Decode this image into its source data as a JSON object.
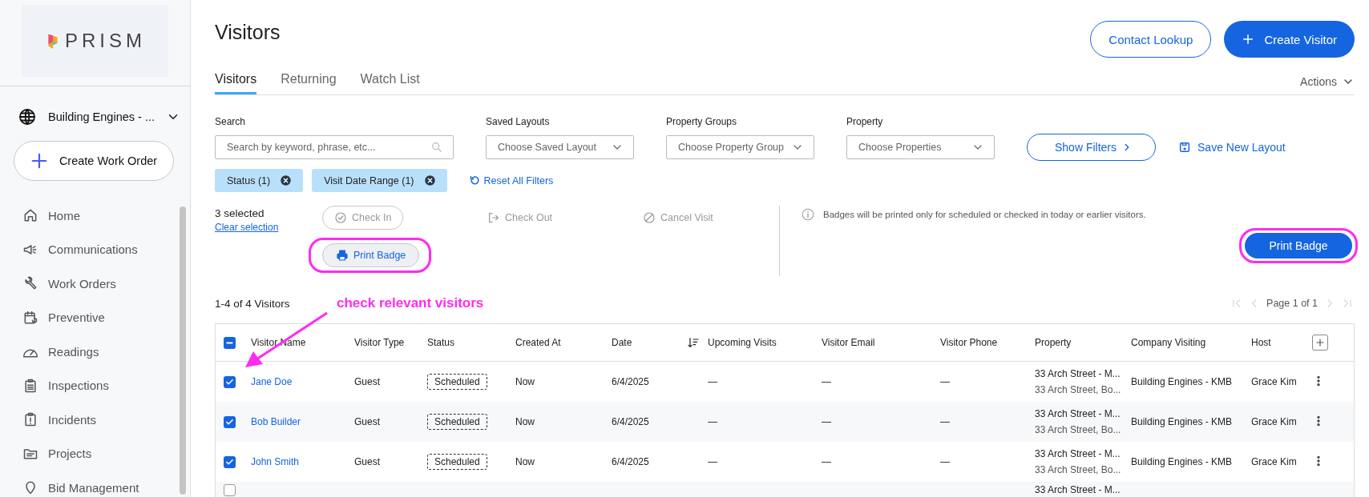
{
  "sidebar": {
    "logo": "PRISM",
    "account": "Building Engines - ...",
    "create_button": "Create Work Order",
    "items": [
      {
        "label": "Home",
        "kind": "home"
      },
      {
        "label": "Communications",
        "kind": "megaphone"
      },
      {
        "label": "Work Orders",
        "kind": "wrench"
      },
      {
        "label": "Preventive",
        "kind": "calendar"
      },
      {
        "label": "Readings",
        "kind": "gauge"
      },
      {
        "label": "Inspections",
        "kind": "clipboard"
      },
      {
        "label": "Incidents",
        "kind": "alert"
      },
      {
        "label": "Projects",
        "kind": "folder"
      },
      {
        "label": "Bid Management",
        "kind": "pin"
      }
    ]
  },
  "header": {
    "title": "Visitors",
    "buttons": [
      {
        "label": "Contact Lookup",
        "kind": "outlined"
      },
      {
        "label": "Create Visitor",
        "kind": "primary"
      }
    ],
    "tabs": [
      {
        "label": "Visitors",
        "selected": true
      },
      {
        "label": "Returning",
        "selected": false
      },
      {
        "label": "Watch List",
        "selected": false
      }
    ],
    "actions_menu": "Actions"
  },
  "filters": {
    "fields": [
      {
        "label": "Search",
        "placeholder": "Search by keyword, phrase, etc...",
        "kind": "search"
      },
      {
        "label": "Saved Layouts",
        "placeholder": "Choose Saved Layout",
        "kind": "select"
      },
      {
        "label": "Property Groups",
        "placeholder": "Choose Property Group",
        "kind": "select"
      },
      {
        "label": "Property",
        "placeholder": "Choose Properties",
        "kind": "select"
      }
    ],
    "show_filters": "Show Filters",
    "save_layout": "Save New Layout",
    "chips": [
      {
        "label": "Status (1)"
      },
      {
        "label": "Visit Date Range (1)"
      }
    ],
    "reset": "Reset All Filters"
  },
  "selection": {
    "count": "3 selected",
    "clear": "Clear selection",
    "actions": [
      {
        "label": "Check In",
        "kind": "check-in",
        "disabled": true,
        "highlighted": false
      },
      {
        "label": "Check Out",
        "kind": "check-out",
        "disabled": true,
        "highlighted": false
      },
      {
        "label": "Cancel Visit",
        "kind": "cancel-visit",
        "disabled": true,
        "highlighted": false
      },
      {
        "label": "Print Badge",
        "kind": "print-badge",
        "disabled": false,
        "highlighted": true
      }
    ],
    "info": "Badges will be printed only for scheduled or checked in today or earlier visitors.",
    "print_button": {
      "label": "Print Badge",
      "highlighted": true
    }
  },
  "list": {
    "count": "1-4 of 4 Visitors",
    "annotation": "check relevant visitors",
    "pagination": "Page 1 of 1"
  },
  "table": {
    "select_all": {
      "indeterminate": true
    },
    "columns": [
      {
        "label": "Visitor Name",
        "sorted": false
      },
      {
        "label": "Visitor Type",
        "sorted": false
      },
      {
        "label": "Status",
        "sorted": false
      },
      {
        "label": "Created At",
        "sorted": false
      },
      {
        "label": "Date",
        "sorted": true
      },
      {
        "label": "Upcoming Visits",
        "sorted": false
      },
      {
        "label": "Visitor Email",
        "sorted": false
      },
      {
        "label": "Visitor Phone",
        "sorted": false
      },
      {
        "label": "Property",
        "sorted": false
      },
      {
        "label": "Company Visiting",
        "sorted": false
      },
      {
        "label": "Host",
        "sorted": false
      }
    ],
    "rows": [
      {
        "checked": true,
        "name": "Jane Doe",
        "type": "Guest",
        "status": "Scheduled",
        "created": "Now",
        "date": "6/4/2025",
        "upcoming": "—",
        "email": "—",
        "phone": "—",
        "property": "33 Arch Street - M...",
        "address": "33 Arch Street, Bo...",
        "company": "Building Engines - KMB",
        "host": "Grace Kim"
      },
      {
        "checked": true,
        "name": "Bob Builder",
        "type": "Guest",
        "status": "Scheduled",
        "created": "Now",
        "date": "6/4/2025",
        "upcoming": "—",
        "email": "—",
        "phone": "—",
        "property": "33 Arch Street - M...",
        "address": "33 Arch Street, Bo...",
        "company": "Building Engines - KMB",
        "host": "Grace Kim"
      },
      {
        "checked": true,
        "name": "John Smith",
        "type": "Guest",
        "status": "Scheduled",
        "created": "Now",
        "date": "6/4/2025",
        "upcoming": "—",
        "email": "—",
        "phone": "—",
        "property": "33 Arch Street - M...",
        "address": "33 Arch Street, Bo...",
        "company": "Building Engines - KMB",
        "host": "Grace Kim"
      },
      {
        "checked": false,
        "property": "33 Arch Street - M..."
      }
    ]
  }
}
